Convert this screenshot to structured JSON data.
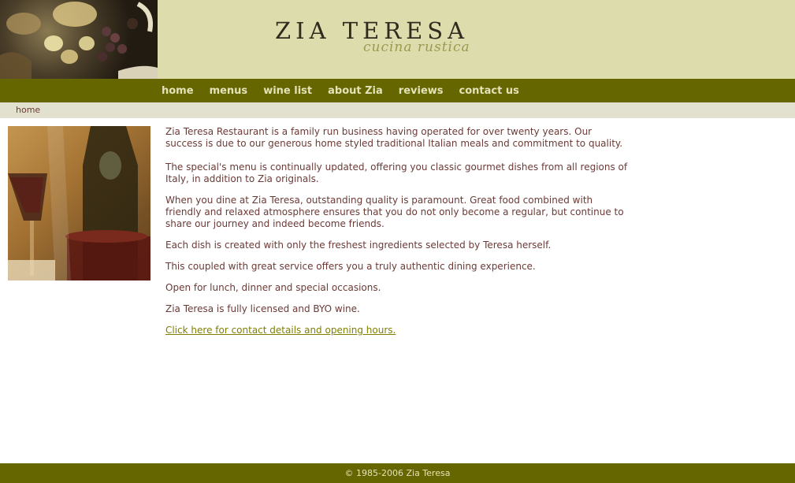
{
  "header": {
    "logo_title": "ZIA TERESA",
    "logo_subtitle": "cucina rustica"
  },
  "nav": {
    "items": [
      {
        "label": "home"
      },
      {
        "label": "menus"
      },
      {
        "label": "wine list"
      },
      {
        "label": "about Zia"
      },
      {
        "label": "reviews"
      },
      {
        "label": "contact us"
      }
    ]
  },
  "breadcrumb": {
    "home": "home"
  },
  "content": {
    "paragraphs": [
      "Zia Teresa Restaurant is a family run business having operated for over twenty years. Our success is due to our generous home styled traditional Italian meals and commitment to quality.",
      "The special's menu is continually updated, offering you classic gourmet dishes from all regions of Italy, in addition to Zia originals.",
      "When you dine at Zia Teresa, outstanding quality is paramount.  Great food combined with friendly and relaxed atmosphere ensures that you do not only become a regular, but continue to share our journey and indeed become friends.",
      "Each dish is created with only the freshest ingredients selected by Teresa herself.",
      "This coupled with great service offers you a truly authentic dining experience.",
      "Open for lunch, dinner and special occasions.",
      "Zia Teresa is fully licensed and BYO wine."
    ],
    "contact_link": "Click here for contact details and opening hours."
  },
  "footer": {
    "copyright": "© 1985-2006 Zia Teresa"
  },
  "colors": {
    "header_bg": "#dddcad",
    "nav_bg": "#666600",
    "nav_text": "#e4e2b8",
    "breadcrumb_bg": "#e2e1cf",
    "body_text": "#6b3a36",
    "link": "#808000"
  }
}
